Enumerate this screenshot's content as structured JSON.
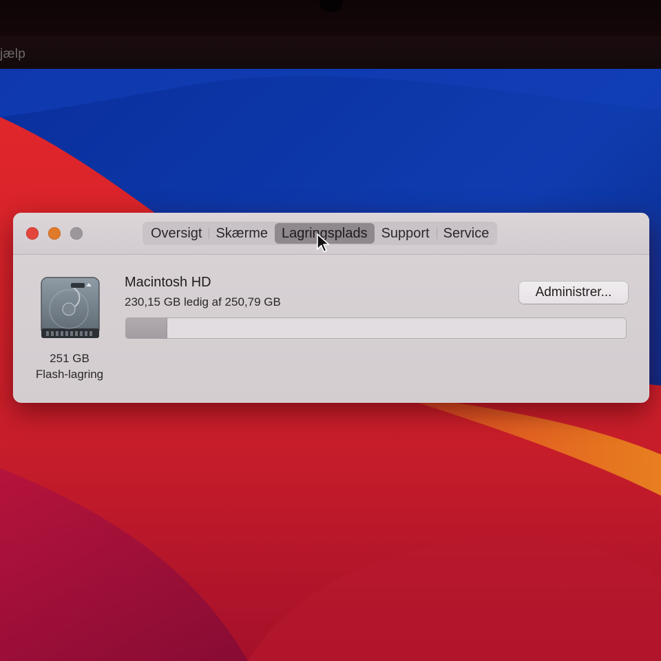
{
  "menubar": {
    "partial_item": "jælp"
  },
  "window": {
    "traffic_lights": {
      "close": "#e2453c",
      "minimize": "#e07a2b",
      "zoom_inactive": "#9c979a"
    },
    "tabs": [
      {
        "label": "Oversigt",
        "active": false
      },
      {
        "label": "Skærme",
        "active": false
      },
      {
        "label": "Lagringsplads",
        "active": true
      },
      {
        "label": "Support",
        "active": false
      },
      {
        "label": "Service",
        "active": false
      }
    ],
    "storage": {
      "disk_icon": "internal-drive-icon",
      "disk_size": "251 GB",
      "disk_type": "Flash-lagring",
      "volume_name": "Macintosh HD",
      "free_text": "230,15 GB ledig af 250,79 GB",
      "used_fraction": 0.082,
      "manage_button": "Administrer..."
    }
  },
  "colors": {
    "wallpaper_blue": "#0d3aa8",
    "wallpaper_red": "#d8262c",
    "wallpaper_orange": "#e0761e"
  }
}
